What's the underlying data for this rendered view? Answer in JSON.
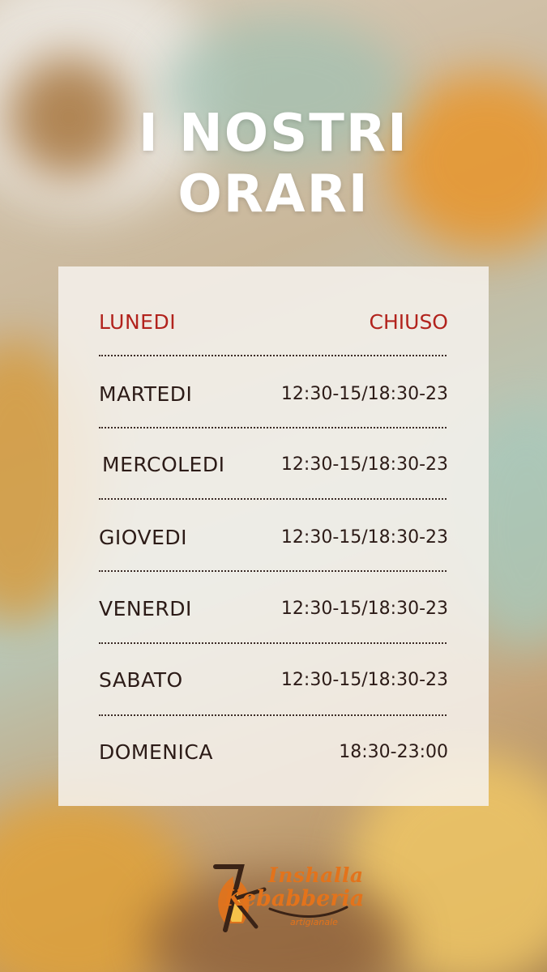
{
  "title": {
    "line1": "I NOSTRI",
    "line2": "ORARI"
  },
  "schedule": [
    {
      "day": "LUNEDI",
      "hours": "CHIUSO",
      "highlight": true
    },
    {
      "day": "MARTEDI",
      "hours": "12:30-15/18:30-23",
      "highlight": false
    },
    {
      "day": "MERCOLEDI",
      "hours": "12:30-15/18:30-23",
      "highlight": false
    },
    {
      "day": "GIOVEDI",
      "hours": "12:30-15/18:30-23",
      "highlight": false
    },
    {
      "day": "VENERDI",
      "hours": "12:30-15/18:30-23",
      "highlight": false
    },
    {
      "day": "SABATO",
      "hours": "12:30-15/18:30-23",
      "highlight": false
    },
    {
      "day": "DOMENICA",
      "hours": "18:30-23:00",
      "highlight": false
    }
  ],
  "logo": {
    "line1": "Inshalla",
    "line2": "Kebabberia",
    "line3": "artigianale"
  },
  "colors": {
    "highlight": "#b2231d",
    "text": "#2c1b17",
    "brand": "#e3731b"
  }
}
